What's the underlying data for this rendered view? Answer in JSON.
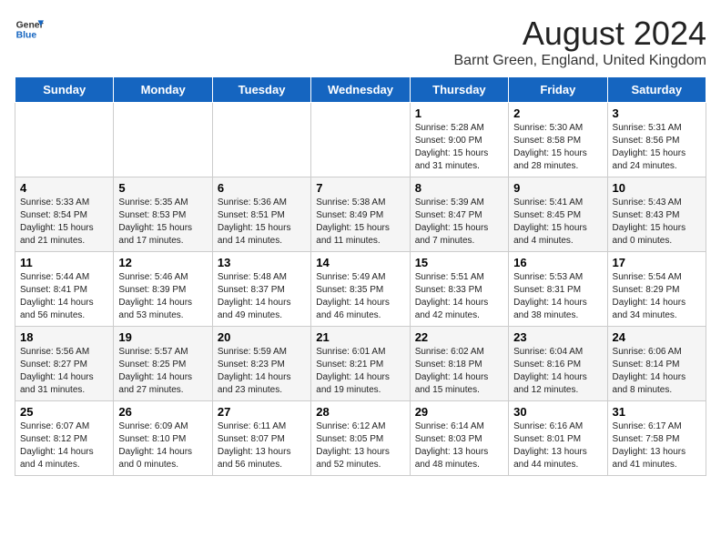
{
  "header": {
    "logo_general": "General",
    "logo_blue": "Blue",
    "month": "August 2024",
    "location": "Barnt Green, England, United Kingdom"
  },
  "days_of_week": [
    "Sunday",
    "Monday",
    "Tuesday",
    "Wednesday",
    "Thursday",
    "Friday",
    "Saturday"
  ],
  "weeks": [
    [
      {
        "day": "",
        "info": ""
      },
      {
        "day": "",
        "info": ""
      },
      {
        "day": "",
        "info": ""
      },
      {
        "day": "",
        "info": ""
      },
      {
        "day": "1",
        "info": "Sunrise: 5:28 AM\nSunset: 9:00 PM\nDaylight: 15 hours\nand 31 minutes."
      },
      {
        "day": "2",
        "info": "Sunrise: 5:30 AM\nSunset: 8:58 PM\nDaylight: 15 hours\nand 28 minutes."
      },
      {
        "day": "3",
        "info": "Sunrise: 5:31 AM\nSunset: 8:56 PM\nDaylight: 15 hours\nand 24 minutes."
      }
    ],
    [
      {
        "day": "4",
        "info": "Sunrise: 5:33 AM\nSunset: 8:54 PM\nDaylight: 15 hours\nand 21 minutes."
      },
      {
        "day": "5",
        "info": "Sunrise: 5:35 AM\nSunset: 8:53 PM\nDaylight: 15 hours\nand 17 minutes."
      },
      {
        "day": "6",
        "info": "Sunrise: 5:36 AM\nSunset: 8:51 PM\nDaylight: 15 hours\nand 14 minutes."
      },
      {
        "day": "7",
        "info": "Sunrise: 5:38 AM\nSunset: 8:49 PM\nDaylight: 15 hours\nand 11 minutes."
      },
      {
        "day": "8",
        "info": "Sunrise: 5:39 AM\nSunset: 8:47 PM\nDaylight: 15 hours\nand 7 minutes."
      },
      {
        "day": "9",
        "info": "Sunrise: 5:41 AM\nSunset: 8:45 PM\nDaylight: 15 hours\nand 4 minutes."
      },
      {
        "day": "10",
        "info": "Sunrise: 5:43 AM\nSunset: 8:43 PM\nDaylight: 15 hours\nand 0 minutes."
      }
    ],
    [
      {
        "day": "11",
        "info": "Sunrise: 5:44 AM\nSunset: 8:41 PM\nDaylight: 14 hours\nand 56 minutes."
      },
      {
        "day": "12",
        "info": "Sunrise: 5:46 AM\nSunset: 8:39 PM\nDaylight: 14 hours\nand 53 minutes."
      },
      {
        "day": "13",
        "info": "Sunrise: 5:48 AM\nSunset: 8:37 PM\nDaylight: 14 hours\nand 49 minutes."
      },
      {
        "day": "14",
        "info": "Sunrise: 5:49 AM\nSunset: 8:35 PM\nDaylight: 14 hours\nand 46 minutes."
      },
      {
        "day": "15",
        "info": "Sunrise: 5:51 AM\nSunset: 8:33 PM\nDaylight: 14 hours\nand 42 minutes."
      },
      {
        "day": "16",
        "info": "Sunrise: 5:53 AM\nSunset: 8:31 PM\nDaylight: 14 hours\nand 38 minutes."
      },
      {
        "day": "17",
        "info": "Sunrise: 5:54 AM\nSunset: 8:29 PM\nDaylight: 14 hours\nand 34 minutes."
      }
    ],
    [
      {
        "day": "18",
        "info": "Sunrise: 5:56 AM\nSunset: 8:27 PM\nDaylight: 14 hours\nand 31 minutes."
      },
      {
        "day": "19",
        "info": "Sunrise: 5:57 AM\nSunset: 8:25 PM\nDaylight: 14 hours\nand 27 minutes."
      },
      {
        "day": "20",
        "info": "Sunrise: 5:59 AM\nSunset: 8:23 PM\nDaylight: 14 hours\nand 23 minutes."
      },
      {
        "day": "21",
        "info": "Sunrise: 6:01 AM\nSunset: 8:21 PM\nDaylight: 14 hours\nand 19 minutes."
      },
      {
        "day": "22",
        "info": "Sunrise: 6:02 AM\nSunset: 8:18 PM\nDaylight: 14 hours\nand 15 minutes."
      },
      {
        "day": "23",
        "info": "Sunrise: 6:04 AM\nSunset: 8:16 PM\nDaylight: 14 hours\nand 12 minutes."
      },
      {
        "day": "24",
        "info": "Sunrise: 6:06 AM\nSunset: 8:14 PM\nDaylight: 14 hours\nand 8 minutes."
      }
    ],
    [
      {
        "day": "25",
        "info": "Sunrise: 6:07 AM\nSunset: 8:12 PM\nDaylight: 14 hours\nand 4 minutes."
      },
      {
        "day": "26",
        "info": "Sunrise: 6:09 AM\nSunset: 8:10 PM\nDaylight: 14 hours\nand 0 minutes."
      },
      {
        "day": "27",
        "info": "Sunrise: 6:11 AM\nSunset: 8:07 PM\nDaylight: 13 hours\nand 56 minutes."
      },
      {
        "day": "28",
        "info": "Sunrise: 6:12 AM\nSunset: 8:05 PM\nDaylight: 13 hours\nand 52 minutes."
      },
      {
        "day": "29",
        "info": "Sunrise: 6:14 AM\nSunset: 8:03 PM\nDaylight: 13 hours\nand 48 minutes."
      },
      {
        "day": "30",
        "info": "Sunrise: 6:16 AM\nSunset: 8:01 PM\nDaylight: 13 hours\nand 44 minutes."
      },
      {
        "day": "31",
        "info": "Sunrise: 6:17 AM\nSunset: 7:58 PM\nDaylight: 13 hours\nand 41 minutes."
      }
    ]
  ]
}
